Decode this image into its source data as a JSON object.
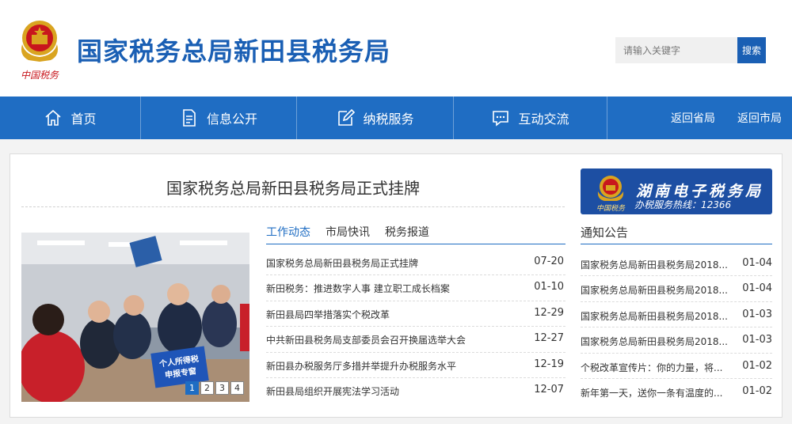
{
  "header": {
    "title": "国家税务总局新田县税务局",
    "emblem_text": "中国税务"
  },
  "search": {
    "placeholder": "请输入关键字",
    "button_label": "搜索"
  },
  "nav": {
    "items": [
      {
        "label": "首页",
        "icon": "home-icon"
      },
      {
        "label": "信息公开",
        "icon": "document-icon"
      },
      {
        "label": "纳税服务",
        "icon": "pen-icon"
      },
      {
        "label": "互动交流",
        "icon": "chat-icon"
      }
    ],
    "links": [
      "返回省局",
      "返回市局"
    ]
  },
  "headline": "国家税务总局新田县税务局正式挂牌",
  "photo": {
    "sign_line1": "个人所得税",
    "sign_line2": "申报专窗",
    "pages": [
      "1",
      "2",
      "3",
      "4"
    ],
    "active_page": 1
  },
  "tabs": [
    "工作动态",
    "市局快讯",
    "税务报道"
  ],
  "news": [
    {
      "title": "国家税务总局新田县税务局正式挂牌",
      "date": "07-20"
    },
    {
      "title": "新田税务：推进数字人事 建立职工成长档案",
      "date": "01-10"
    },
    {
      "title": "新田县局四举措落实个税改革",
      "date": "12-29"
    },
    {
      "title": "中共新田县税务局支部委员会召开换届选举大会",
      "date": "12-27"
    },
    {
      "title": "新田县办税服务厅多措并举提升办税服务水平",
      "date": "12-19"
    },
    {
      "title": "新田县局组织开展宪法学习活动",
      "date": "12-07"
    }
  ],
  "banner": {
    "title": "湖南电子税务局",
    "subtitle": "办税服务热线：12366",
    "logo_text": "中国税务"
  },
  "notice": {
    "heading": "通知公告",
    "items": [
      {
        "title": "国家税务总局新田县税务局2018...",
        "date": "01-04"
      },
      {
        "title": "国家税务总局新田县税务局2018...",
        "date": "01-04"
      },
      {
        "title": "国家税务总局新田县税务局2018...",
        "date": "01-03"
      },
      {
        "title": "国家税务总局新田县税务局2018...",
        "date": "01-03"
      },
      {
        "title": "个税改革宣传片：你的力量，将...",
        "date": "01-02"
      },
      {
        "title": "新年第一天，送你一条有温度的...",
        "date": "01-02"
      }
    ]
  },
  "colors": {
    "brand_blue": "#1f6dc3",
    "title_blue": "#1a5fb4",
    "emblem_red": "#c8161d",
    "emblem_gold": "#d9a420"
  }
}
